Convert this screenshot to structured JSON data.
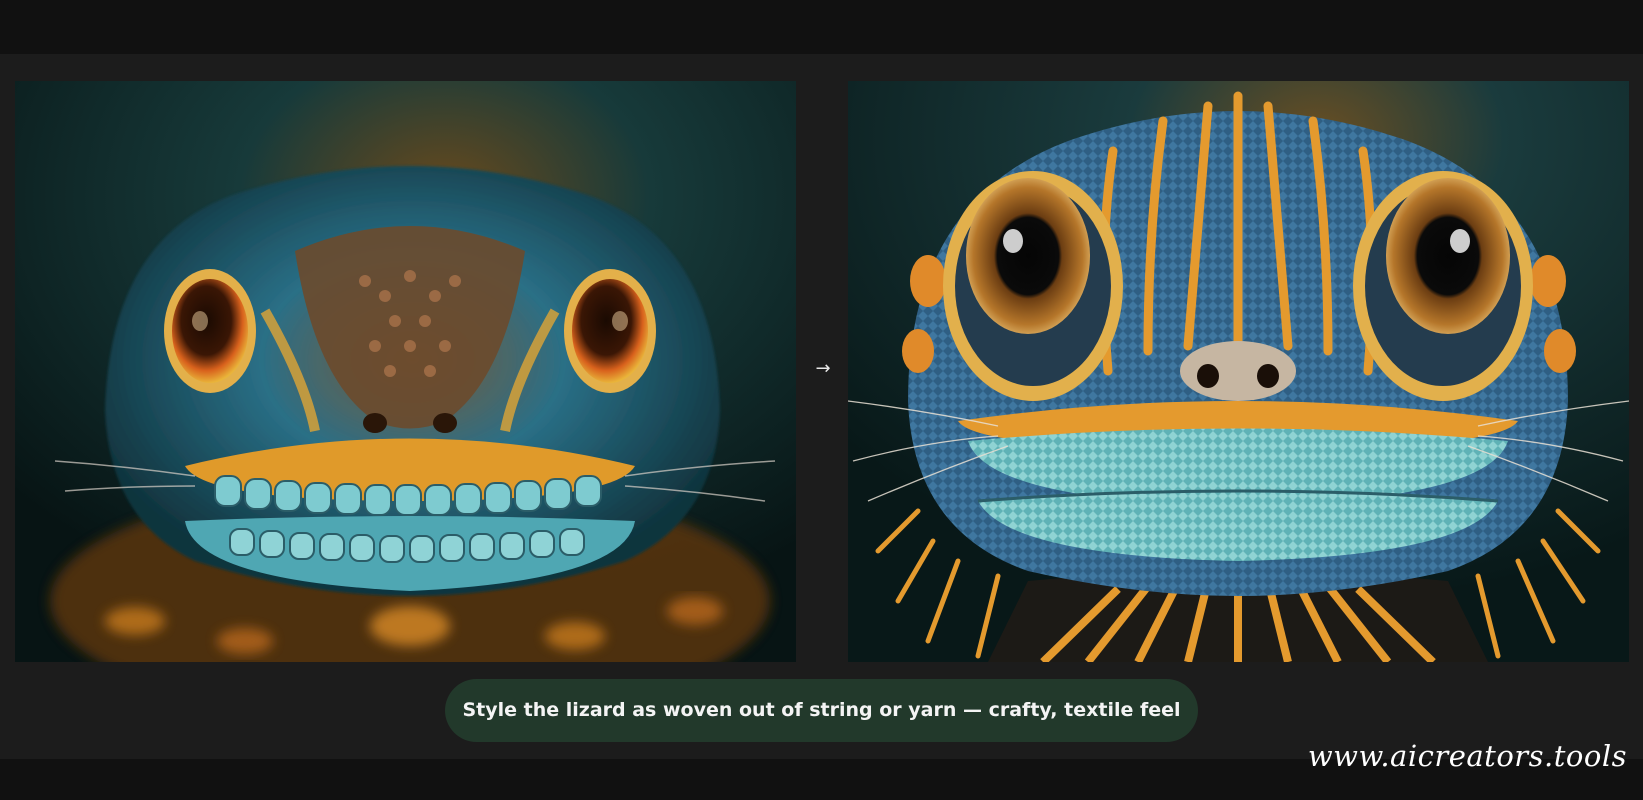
{
  "images": {
    "before": {
      "icon": "lizard-face-photo",
      "colors": {
        "background": "#0e2a2b",
        "skin_blue": "#2a6f86",
        "skin_teal": "#5fb9c0",
        "accent_orange": "#e0891f",
        "eye": "#d8611c"
      }
    },
    "after": {
      "icon": "yarn-lizard-face",
      "colors": {
        "background": "#0e2a2b",
        "yarn_blue": "#2f5f84",
        "yarn_teal": "#7cc5c7",
        "yarn_orange": "#e49a2e",
        "eye": "#b5762a"
      }
    }
  },
  "arrow": {
    "glyph": "→",
    "icon": "arrow-right-icon"
  },
  "prompt": {
    "text": "Style the lizard as woven out of string or yarn — crafty, textile feel",
    "background": "#22392b"
  },
  "watermark": {
    "text": "www.aicreators.tools"
  }
}
